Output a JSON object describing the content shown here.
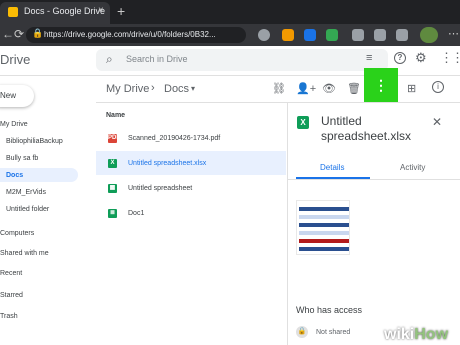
{
  "browser": {
    "tab_title": "Docs - Google Drive",
    "tab_close": "×",
    "new_tab": "+",
    "back": "←",
    "refresh": "⟳",
    "lock": "🔒",
    "url": "https://drive.google.com/drive/u/0/folders/0B32...",
    "menu": "⋯"
  },
  "header": {
    "app_title": "Drive",
    "search_placeholder": "Search in Drive",
    "search_icon": "⌕",
    "tune_icon": "≡",
    "help": "?",
    "settings": "⚙",
    "apps": "⋮⋮⋮"
  },
  "sidebar": {
    "new_label": "New",
    "items": [
      "My Drive",
      "BibliophiliaBackup",
      "Bully sa fb",
      "Docs",
      "M2M_ErVids",
      "Untitled folder",
      "Computers",
      "Shared with me",
      "Recent",
      "Starred",
      "Trash"
    ]
  },
  "breadcrumb": {
    "root": "My Drive",
    "separator": "›",
    "current": "Docs",
    "caret": "▾"
  },
  "toolbar": {
    "link": "⛓",
    "share": "👤+",
    "preview": "👁",
    "delete": "🗑",
    "more": "⋮",
    "grid": "⊞",
    "info": "i"
  },
  "file_list": {
    "column_name": "Name",
    "files": [
      {
        "name": "Scanned_20190426-1734.pdf",
        "icon": "PDF",
        "color": "#db4437",
        "selected": false
      },
      {
        "name": "Untitled spreadsheet.xlsx",
        "icon": "X",
        "color": "#0f9d58",
        "selected": true
      },
      {
        "name": "Untitled spreadsheet",
        "icon": "▦",
        "color": "#0f9d58",
        "selected": false
      },
      {
        "name": "Doc1",
        "icon": "≣",
        "color": "#0f9d58",
        "selected": false
      }
    ]
  },
  "details": {
    "icon": "X",
    "title": "Untitled spreadsheet.xlsx",
    "close": "✕",
    "tab_details": "Details",
    "tab_activity": "Activity",
    "access_heading": "Who has access",
    "lock": "🔒",
    "not_shared": "Not shared"
  },
  "watermark": {
    "wiki": "wiki",
    "how": "How"
  },
  "colors": {
    "accent": "#1a73e8",
    "highlight": "#2ad21a",
    "sheets_green": "#0f9d58",
    "pdf_red": "#db4437"
  }
}
